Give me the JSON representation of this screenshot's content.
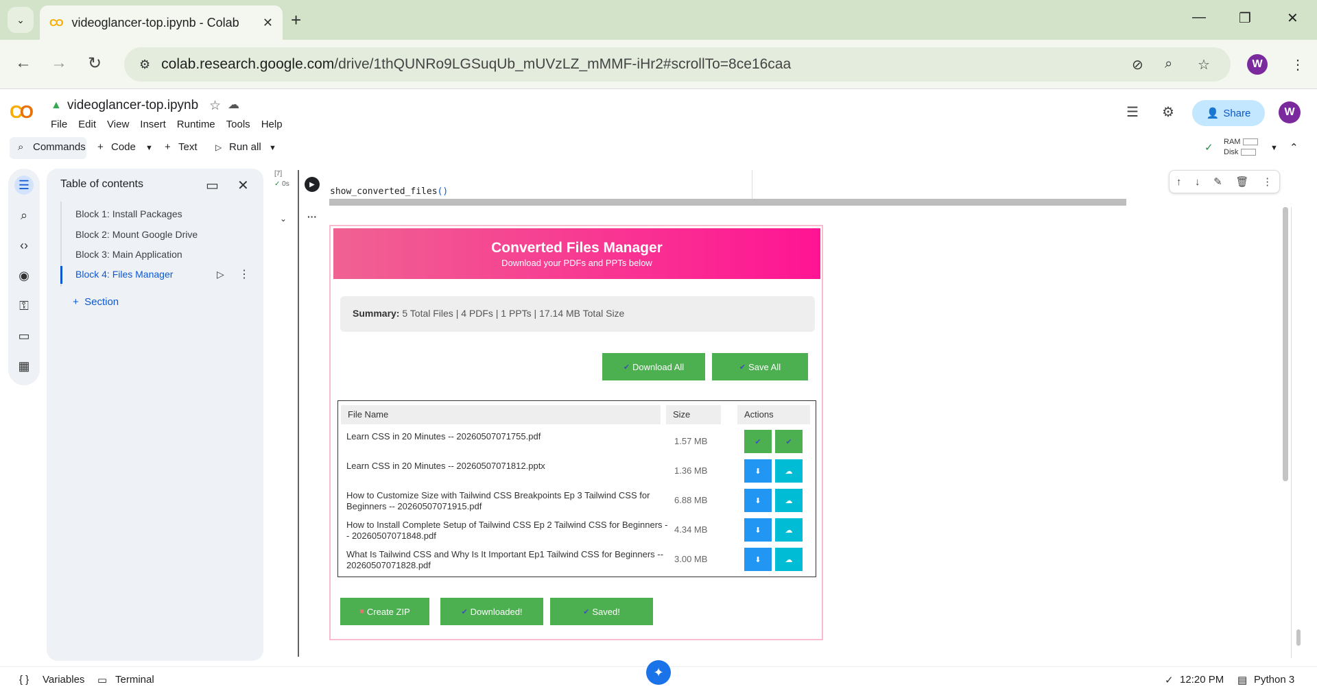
{
  "browser": {
    "tab_title": "videoglancer-top.ipynb - Colab",
    "url_host": "colab.research.google.com",
    "url_path": "/drive/1thQUNRo9LGSuqUb_mUVzLZ_mMMF-iHr2#scrollTo=8ce16caa",
    "profile_initial": "W"
  },
  "colab": {
    "notebook_title": "videoglancer-top.ipynb",
    "menu": [
      "File",
      "Edit",
      "View",
      "Insert",
      "Runtime",
      "Tools",
      "Help"
    ],
    "share_label": "Share",
    "profile_initial": "W"
  },
  "toolbar": {
    "commands": "Commands",
    "code": "Code",
    "text": "Text",
    "run_all": "Run all",
    "ram": "RAM",
    "disk": "Disk"
  },
  "toc": {
    "title": "Table of contents",
    "items": [
      "Block 1: Install Packages",
      "Block 2: Mount Google Drive",
      "Block 3: Main Application",
      "Block 4: Files Manager"
    ],
    "section_label": "Section"
  },
  "cell": {
    "exec_count": "[7]",
    "exec_time": "0s",
    "code_fn": "show_converted_files",
    "code_parens": "()"
  },
  "widget": {
    "title": "Converted Files Manager",
    "subtitle": "Download your PDFs and PPTs below",
    "summary_label": "Summary:",
    "summary_text": "5 Total Files | 4 PDFs | 1 PPTs | 17.14 MB Total Size",
    "download_all": "Download All",
    "save_all": "Save All",
    "columns": [
      "File Name",
      "Size",
      "Actions"
    ],
    "rows": [
      {
        "name": "Learn CSS in 20 Minutes -- 20260507071755.pdf",
        "size": "1.57 MB"
      },
      {
        "name": "Learn CSS in 20 Minutes -- 20260507071812.pptx",
        "size": "1.36 MB"
      },
      {
        "name": "How to Customize Size with Tailwind CSS Breakpoints Ep 3 Tailwind CSS for Beginners -- 20260507071915.pdf",
        "size": "6.88 MB"
      },
      {
        "name": "How to Install Complete Setup of Tailwind CSS Ep 2 Tailwind CSS for Beginners -- 20260507071848.pdf",
        "size": "4.34 MB"
      },
      {
        "name": "What Is Tailwind CSS and Why Is It Important Ep1 Tailwind CSS for Beginners -- 20260507071828.pdf",
        "size": "3.00 MB"
      }
    ],
    "create_zip": "Create ZIP",
    "downloaded": "Downloaded!",
    "saved": "Saved!"
  },
  "status": {
    "variables": "Variables",
    "terminal": "Terminal",
    "time": "12:20 PM",
    "runtime": "Python 3"
  },
  "colors": {
    "banner_start": "#f06292",
    "banner_end": "#ff1493",
    "green": "#4caf50",
    "blue": "#2196f3",
    "cyan": "#00bcd4",
    "colab_blue": "#0b57d0"
  }
}
